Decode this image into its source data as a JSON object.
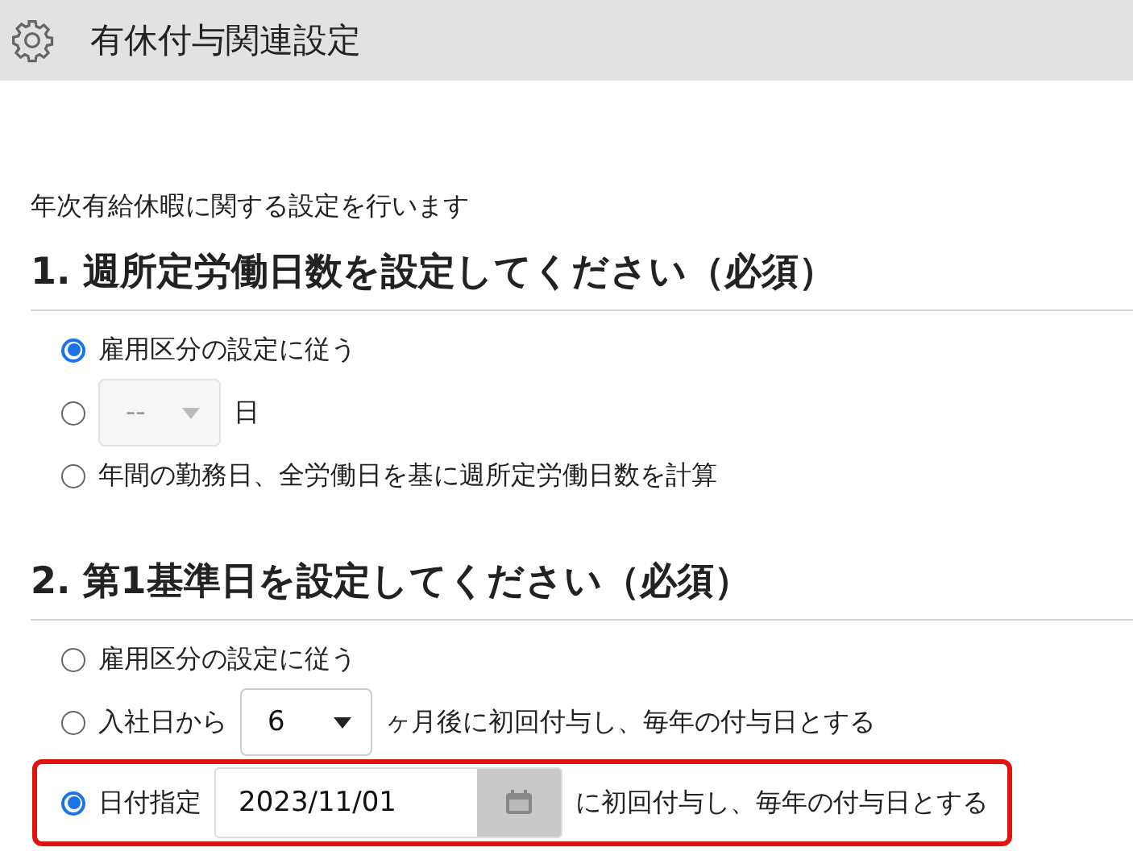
{
  "header": {
    "title": "有休付与関連設定"
  },
  "intro": "年次有給休暇に関する設定を行います",
  "sections": [
    {
      "heading": "1. 週所定労働日数を設定してください（必須）",
      "options": [
        {
          "kind": "plain",
          "selected": true,
          "highlighted": false,
          "label": "雇用区分の設定に従う"
        },
        {
          "kind": "select",
          "selected": false,
          "highlighted": false,
          "value": "--",
          "disabled": true,
          "suffix": "日"
        },
        {
          "kind": "plain",
          "selected": false,
          "highlighted": false,
          "label": "年間の勤務日、全労働日を基に週所定労働日数を計算"
        }
      ]
    },
    {
      "heading": "2. 第1基準日を設定してください（必須）",
      "options": [
        {
          "kind": "plain",
          "selected": false,
          "highlighted": false,
          "label": "雇用区分の設定に従う"
        },
        {
          "kind": "select",
          "selected": false,
          "highlighted": false,
          "label": "入社日から",
          "value": "6",
          "disabled": false,
          "suffix": "ヶ月後に初回付与し、毎年の付与日とする"
        },
        {
          "kind": "date",
          "selected": true,
          "highlighted": true,
          "label": "日付指定",
          "value": "2023/11/01",
          "suffix": "に初回付与し、毎年の付与日とする"
        }
      ]
    }
  ]
}
